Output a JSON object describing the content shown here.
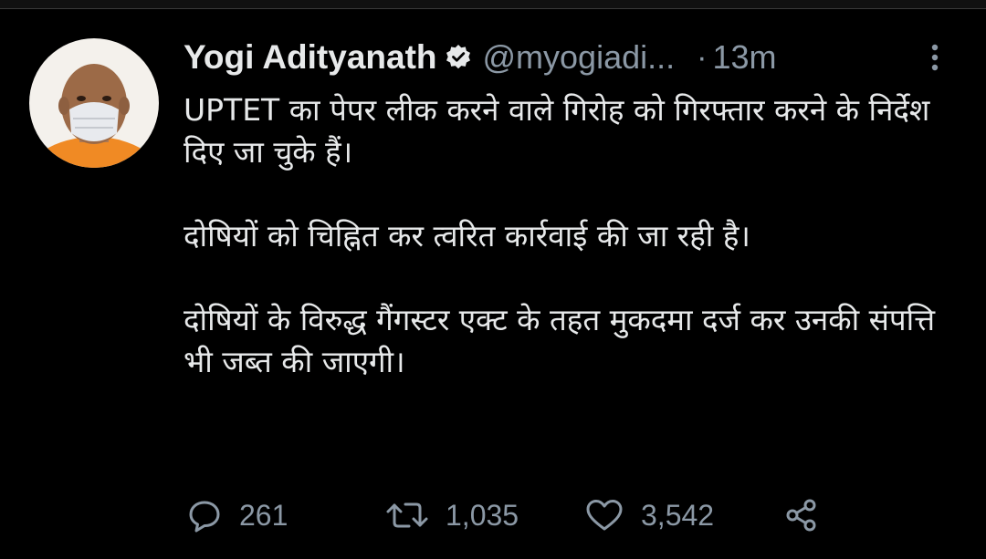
{
  "tweet": {
    "author": {
      "display_name": "Yogi Adityanath",
      "handle": "@myogiadi...",
      "verified": true,
      "avatar": "profile-photo"
    },
    "separator": "·",
    "time": "13m",
    "paragraphs": [
      "UPTET का पेपर लीक करने वाले गिरोह को गिरफ्तार करने के निर्देश दिए जा चुके हैं।",
      "दोषियों को चिह्नित कर त्वरित कार्रवाई की जा रही है।",
      "दोषियों के विरुद्ध गैंगस्टर एक्ट के तहत मुकदमा दर्ज कर उनकी संपत्ति भी जब्त की जाएगी।"
    ],
    "actions": {
      "reply_count": "261",
      "retweet_count": "1,035",
      "like_count": "3,542"
    }
  },
  "icons": {
    "verified": "verified-badge-icon",
    "more": "more-vertical-icon",
    "reply": "reply-icon",
    "retweet": "retweet-icon",
    "like": "heart-icon",
    "share": "share-icon"
  },
  "colors": {
    "background": "#000000",
    "primary_text": "#e7e9ea",
    "secondary_text": "#8b98a5"
  }
}
